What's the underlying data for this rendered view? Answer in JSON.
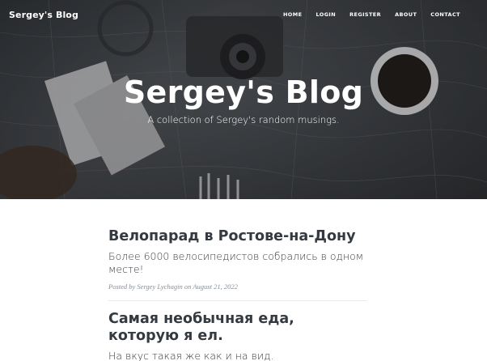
{
  "brand": "Sergey's Blog",
  "nav": [
    {
      "label": "HOME"
    },
    {
      "label": "LOGIN"
    },
    {
      "label": "REGISTER"
    },
    {
      "label": "ABOUT"
    },
    {
      "label": "CONTACT"
    }
  ],
  "hero": {
    "title": "Sergey's Blog",
    "subtitle": "A collection of Sergey's random musings."
  },
  "posts": [
    {
      "title": "Велопарад в Ростове-на-Дону",
      "subtitle": "Более 6000 велосипедистов собрались в одном месте!",
      "meta_prefix": "Posted by",
      "author": "Sergey Lychagin",
      "meta_on": "on",
      "date": "August 21, 2022"
    },
    {
      "title": "Самая необычная еда, которую я ел.",
      "subtitle": "На вкус такая же как и на вид."
    }
  ],
  "colors": {
    "heading": "#343a40",
    "meta": "#868e96",
    "divider": "#e9ecef"
  }
}
